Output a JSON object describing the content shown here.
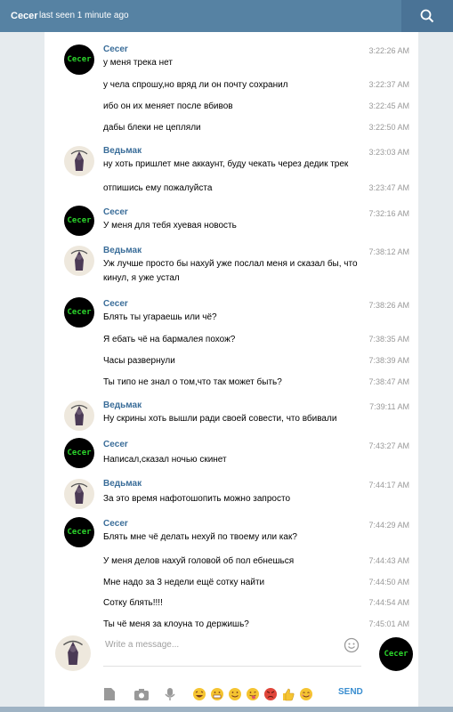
{
  "header": {
    "name": "Cecer",
    "status": "last seen 1 minute ago"
  },
  "messages": [
    {
      "author": "Cecer",
      "text": "у меня трека нет",
      "time": "3:22:26 AM"
    },
    {
      "author": "",
      "text": "у чела спрошу,но вряд ли он почту сохранил",
      "time": "3:22:37 AM"
    },
    {
      "author": "",
      "text": "ибо он их меняет после вбивов",
      "time": "3:22:45 AM"
    },
    {
      "author": "",
      "text": "дабы блеки не цепляли",
      "time": "3:22:50 AM"
    },
    {
      "author": "Ведьмак",
      "text": "ну хоть пришлет мне аккаунт, буду чекать через дедик трек",
      "time": "3:23:03 AM"
    },
    {
      "author": "",
      "text": "отпишись ему пожалуйста",
      "time": "3:23:47 AM"
    },
    {
      "author": "Cecer",
      "text": "У меня для тебя хуевая новость",
      "time": "7:32:16 AM"
    },
    {
      "author": "Ведьмак",
      "text": "Уж лучше просто бы нахуй уже послал меня и сказал бы, что кинул, я уже устал",
      "time": "7:38:12 AM"
    },
    {
      "author": "Cecer",
      "text": "Блять ты угараешь или чё?",
      "time": "7:38:26 AM"
    },
    {
      "author": "",
      "text": "Я ебать чё на бармалея похож?",
      "time": "7:38:35 AM"
    },
    {
      "author": "",
      "text": "Часы развернули",
      "time": "7:38:39 AM"
    },
    {
      "author": "",
      "text": "Ты типо не знал о том,что так может быть?",
      "time": "7:38:47 AM"
    },
    {
      "author": "Ведьмак",
      "text": "Ну скрины хоть вышли ради своей совести, что вбивали",
      "time": "7:39:11 AM"
    },
    {
      "author": "Cecer",
      "text": "Написал,сказал ночью скинет",
      "time": "7:43:27 AM"
    },
    {
      "author": "Ведьмак",
      "text": "За это время нафотошопить можно запросто",
      "time": "7:44:17 AM"
    },
    {
      "author": "Cecer",
      "text": "Блять мне чё делать нехуй по твоему или как?",
      "time": "7:44:29 AM"
    },
    {
      "author": "",
      "text": "У меня делов нахуй головой об пол ебнешься",
      "time": "7:44:43 AM"
    },
    {
      "author": "",
      "text": "Мне надо за 3 недели ещё сотку найти",
      "time": "7:44:50 AM"
    },
    {
      "author": "",
      "text": "Сотку блять!!!!",
      "time": "7:44:54 AM"
    },
    {
      "author": "",
      "text": "Ты чё меня за клоуна то держишь?",
      "time": "7:45:01 AM"
    }
  ],
  "composer": {
    "placeholder": "Write a message...",
    "send_label": "SEND"
  },
  "avatar_text": {
    "cecer": "Cecer"
  },
  "toolbar_icons": [
    "document-icon",
    "camera-icon",
    "microphone-icon",
    "laughing-emoji-icon",
    "grinning-emoji-icon",
    "smile-emoji-icon",
    "tongue-emoji-icon",
    "angry-emoji-icon",
    "thumbs-up-emoji-icon",
    "blush-emoji-icon"
  ],
  "colors": {
    "header": "#5682a3",
    "author": "#3a6d99",
    "send": "#3a8ed0",
    "background": "#e6ebee"
  }
}
